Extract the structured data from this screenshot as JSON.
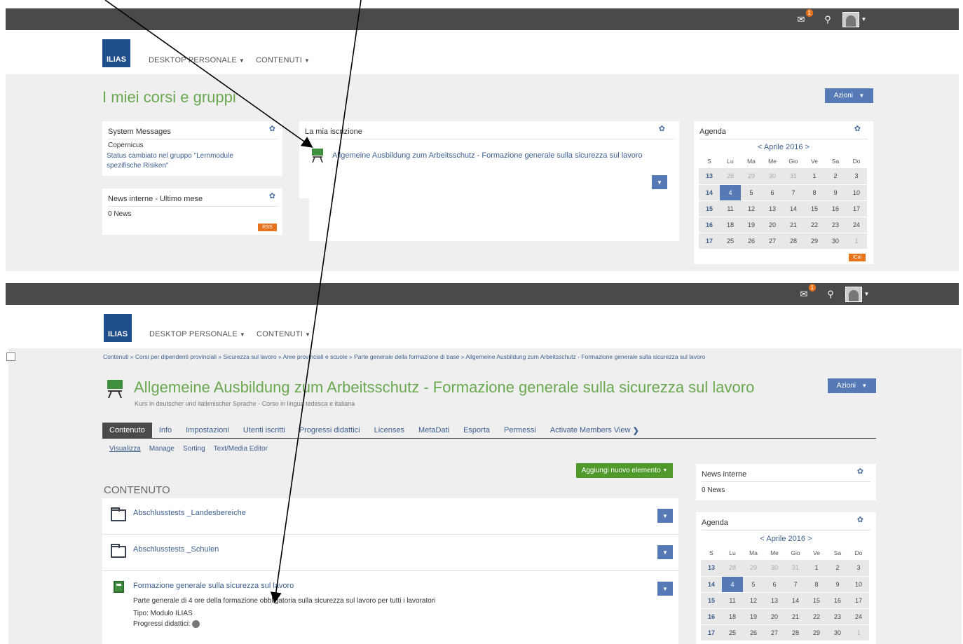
{
  "header": {
    "logo": "ILIAS",
    "mail_count": "1",
    "nav": [
      "DESKTOP PERSONALE",
      "CONTENUTI"
    ]
  },
  "top": {
    "page_title": "I miei corsi e gruppi",
    "actions_label": "Azioni",
    "system_messages": {
      "title": "System Messages",
      "sender": "Copernicus",
      "message": "Status cambiato nel gruppo \"Lernmodule spezifische Risiken\""
    },
    "news": {
      "title": "News interne - Ultimo mese",
      "count": "0 News",
      "rss": "RSS"
    },
    "enrollment": {
      "title": "La mia iscrizione",
      "course_title": "Allgemeine Ausbildung zum Arbeitsschutz - Formazione generale sulla sicurezza sul lavoro"
    },
    "agenda": {
      "title": "Agenda",
      "month": "< Aprile 2016 >",
      "ical": "iCal"
    }
  },
  "calendar": {
    "headers": [
      "S",
      "Lu",
      "Ma",
      "Me",
      "Gio",
      "Ve",
      "Sa",
      "Do"
    ],
    "weeks": [
      {
        "wk": "13",
        "days": [
          "28",
          "29",
          "30",
          "31",
          "1",
          "2",
          "3"
        ]
      },
      {
        "wk": "14",
        "days": [
          "4",
          "5",
          "6",
          "7",
          "8",
          "9",
          "10"
        ]
      },
      {
        "wk": "15",
        "days": [
          "11",
          "12",
          "13",
          "14",
          "15",
          "16",
          "17"
        ]
      },
      {
        "wk": "16",
        "days": [
          "18",
          "19",
          "20",
          "21",
          "22",
          "23",
          "24"
        ]
      },
      {
        "wk": "17",
        "days": [
          "25",
          "26",
          "27",
          "28",
          "29",
          "30",
          "1"
        ]
      }
    ]
  },
  "bottom": {
    "breadcrumb": "Contenuti  »  Corsi per dipendenti provinciali  »  Sicurezza sul lavoro  »  Aree provinciali e scuole  »  Parte generale della formazione di base  »  Allgemeine Ausbildung zum Arbeitsschutz - Formazione generale sulla sicurezza sul lavoro",
    "course_title": "Allgemeine Ausbildung zum Arbeitsschutz - Formazione generale sulla sicurezza sul lavoro",
    "course_subtitle": "Kurs in deutscher und italienischer Sprache - Corso in lingua tedesca e italiana",
    "actions_label": "Azioni",
    "tabs": [
      "Contenuto",
      "Info",
      "Impostazioni",
      "Utenti iscritti",
      "Progressi didattici",
      "Licenses",
      "MetaDati",
      "Esporta",
      "Permessi",
      "Activate Members View"
    ],
    "subtabs": [
      "Visualizza",
      "Manage",
      "Sorting",
      "Text/Media Editor"
    ],
    "add_button": "Aggiungi nuovo elemento",
    "section_title": "CONTENUTO",
    "items": [
      {
        "title": "Abschlusstests _Landesbereiche"
      },
      {
        "title": "Abschlusstests _Schulen"
      },
      {
        "title": "Formazione generale sulla sicurezza sul lavoro",
        "description": "Parte generale di 4 ore della formazione obbligatoria sulla sicurezza sul lavoro per tutti i lavoratori",
        "type": "Tipo: Modulo ILIAS",
        "progress": "Progressi didattici:"
      }
    ],
    "news": {
      "title": "News interne",
      "count": "0 News"
    },
    "agenda": {
      "title": "Agenda",
      "month": "< Aprile 2016 >"
    }
  },
  "colors": {
    "accent": "#557ab5",
    "title_green": "#6aa84f",
    "topbar": "#4a4a4a",
    "rss": "#e8731d"
  }
}
